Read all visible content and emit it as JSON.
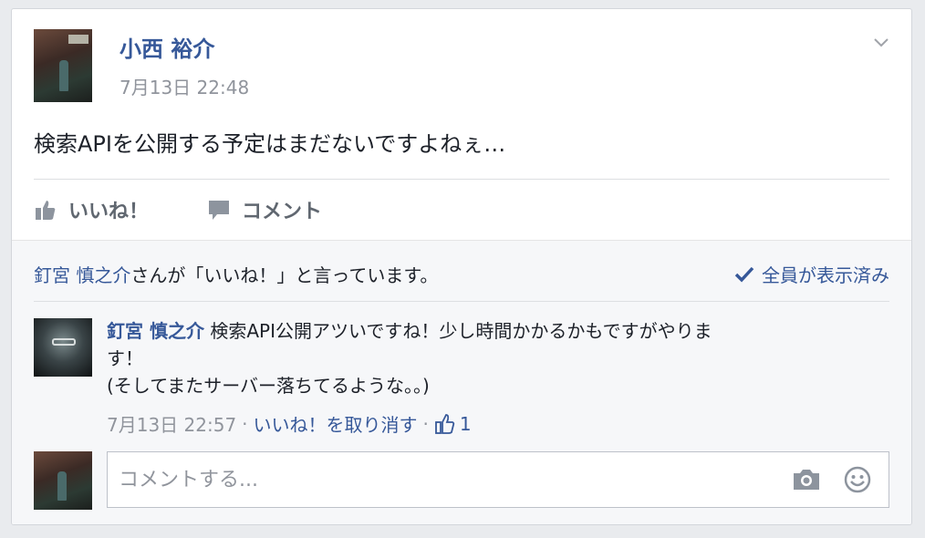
{
  "post": {
    "author": "小西 裕介",
    "timestamp": "7月13日 22:48",
    "body": "検索APIを公開する予定はまだないですよねぇ…",
    "actions": {
      "like_label": "いいね！",
      "comment_label": "コメント"
    }
  },
  "likes": {
    "liker_name": "釘宮 慎之介",
    "liker_suffix": "さんが「いいね！」と言っています。",
    "seen_label": "全員が表示済み"
  },
  "comment": {
    "author": "釘宮 慎之介",
    "text_line1": "検索API公開アツいですね！少し時間かかるかもですがやりま",
    "text_line2": "す！",
    "text_line3": "(そしてまたサーバー落ちてるような。。)",
    "timestamp": "7月13日 22:57",
    "unlike_label": "いいね！を取り消す",
    "like_count": "1"
  },
  "reply": {
    "placeholder": "コメントする..."
  },
  "colors": {
    "link_blue": "#365899",
    "muted_gray": "#90949c",
    "action_gray": "#606770"
  }
}
